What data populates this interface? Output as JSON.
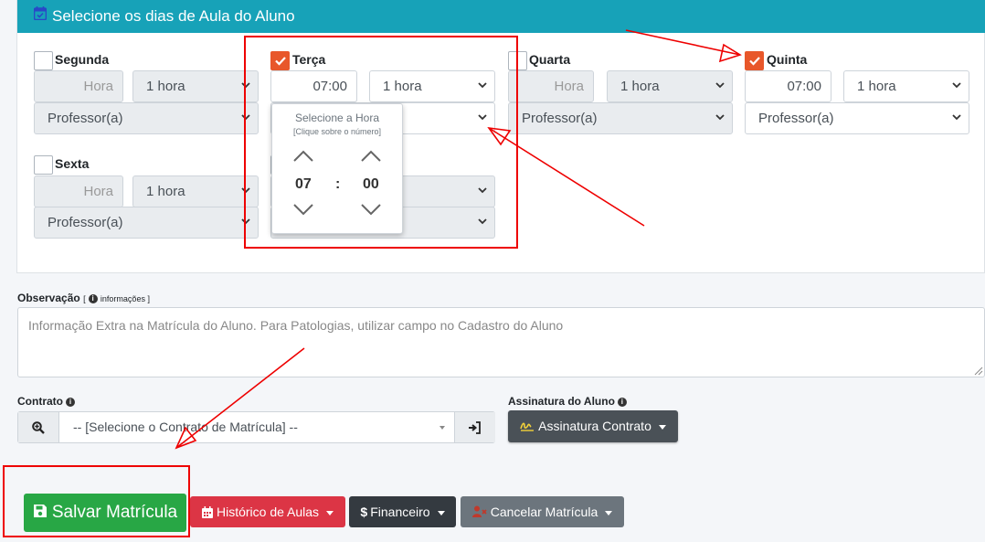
{
  "header": {
    "title": "Selecione os dias de Aula do Aluno"
  },
  "days": [
    {
      "name": "Segunda",
      "checked": false,
      "time": "Hora",
      "duration": "1 hora",
      "teacher": "Professor(a)"
    },
    {
      "name": "Terça",
      "checked": true,
      "time": "07:00",
      "duration": "1 hora",
      "teacher": ""
    },
    {
      "name": "Quarta",
      "checked": false,
      "time": "Hora",
      "duration": "1 hora",
      "teacher": "Professor(a)"
    },
    {
      "name": "Quinta",
      "checked": true,
      "time": "07:00",
      "duration": "1 hora",
      "teacher": "Professor(a)"
    },
    {
      "name": "Sexta",
      "checked": false,
      "time": "Hora",
      "duration": "1 hora",
      "teacher": "Professor(a)"
    },
    {
      "name": "",
      "checked": false,
      "time": "",
      "duration": "ora",
      "teacher": ""
    }
  ],
  "time_picker": {
    "title": "Selecione a Hora",
    "subtitle": "[Clique sobre o número]",
    "hour": "07",
    "separator": ":",
    "minute": "00"
  },
  "observation": {
    "label": "Observação",
    "info": "informações ]",
    "info_prefix": "[",
    "placeholder": "Informação Extra na Matrícula do Aluno. Para Patologias, utilizar campo no Cadastro do Aluno"
  },
  "contract": {
    "label": "Contrato",
    "select_value": "-- [Selecione o Contrato de Matrícula] --"
  },
  "signature": {
    "label": "Assinatura do Aluno",
    "button": "Assinatura Contrato"
  },
  "actions": {
    "save": "Salvar Matrícula",
    "history": "Histórico de Aulas",
    "finance": "Financeiro",
    "cancel": "Cancelar Matrícula"
  },
  "colors": {
    "header": "#17a2b8",
    "checkbox_on": "#e8572a",
    "save": "#28a745",
    "history": "#dc3545",
    "finance": "#343a40",
    "cancel": "#6c757d",
    "annotation": "#ee0000"
  }
}
